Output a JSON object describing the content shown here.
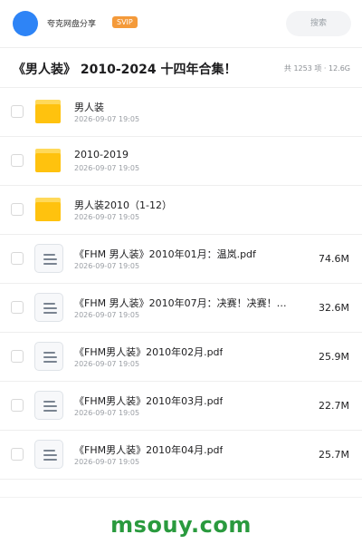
{
  "header": {
    "avatar": "avatar",
    "username": "夸克网盘分享",
    "badge": "SVIP",
    "search_placeholder": "搜索"
  },
  "share": {
    "title": "《男人装》 2010-2024 十四年合集！",
    "meta": "共 1253 项 · 12.6G"
  },
  "files": [
    {
      "type": "folder",
      "icon": "folder-icon",
      "name": "男人装",
      "date": "2026-09-07 19:05",
      "size": ""
    },
    {
      "type": "folder",
      "icon": "folder-icon",
      "name": "2010-2019",
      "date": "2026-09-07 19:05",
      "size": ""
    },
    {
      "type": "folder",
      "icon": "folder-icon",
      "name": "男人装2010（1-12）",
      "date": "2026-09-07 19:05",
      "size": ""
    },
    {
      "type": "file",
      "icon": "document-icon",
      "name": "《FHM 男人装》2010年01月：温岚.pdf",
      "date": "2026-09-07 19:05",
      "size": "74.6M"
    },
    {
      "type": "file",
      "icon": "document-icon",
      "name": "《FHM 男人装》2010年07月：决赛！决赛！！…",
      "date": "2026-09-07 19:05",
      "size": "32.6M"
    },
    {
      "type": "file",
      "icon": "document-icon",
      "name": "《FHM男人装》2010年02月.pdf",
      "date": "2026-09-07 19:05",
      "size": "25.9M"
    },
    {
      "type": "file",
      "icon": "document-icon",
      "name": "《FHM男人装》2010年03月.pdf",
      "date": "2026-09-07 19:05",
      "size": "22.7M"
    },
    {
      "type": "file",
      "icon": "document-icon",
      "name": "《FHM男人装》2010年04月.pdf",
      "date": "2026-09-07 19:05",
      "size": "25.7M"
    }
  ],
  "footer": {
    "watermark": "msouy.com"
  },
  "colors": {
    "accent": "#2e84f6",
    "svip": "#f49a3a",
    "folder": "#ffc20e",
    "watermark": "#2a9a3e"
  }
}
